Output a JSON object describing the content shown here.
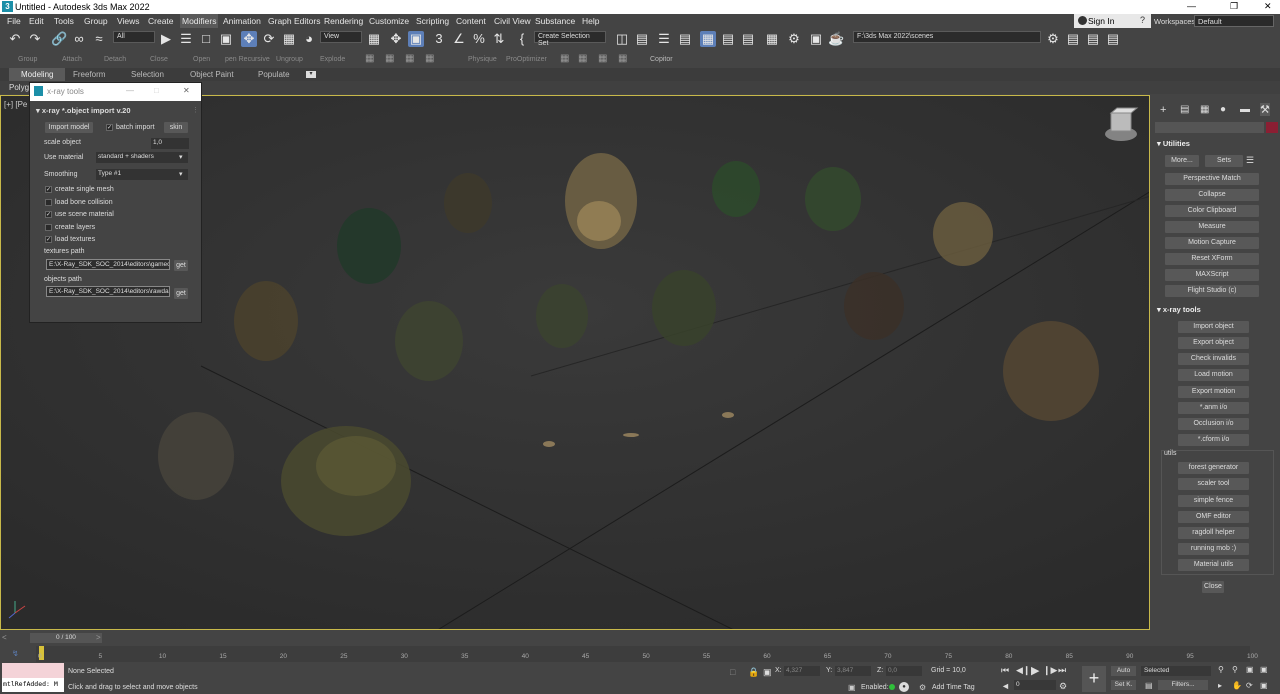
{
  "window": {
    "title": "Untitled - Autodesk 3ds Max 2022"
  },
  "menu": [
    "File",
    "Edit",
    "Tools",
    "Group",
    "Views",
    "Create",
    "Modifiers",
    "Animation",
    "Graph Editors",
    "Rendering",
    "Customize",
    "Scripting",
    "Content",
    "Civil View",
    "Substance",
    "Help"
  ],
  "sign_in": "Sign In",
  "workspace": {
    "label": "Workspaces:",
    "value": "Default"
  },
  "toolbar": {
    "filter": "All",
    "ref_coord": "View",
    "selection_set": "Create Selection Set",
    "path": "F:\\3ds Max 2022\\scenes"
  },
  "ribbon_labels": [
    "Group",
    "Attach",
    "Detach",
    "Close",
    "Open",
    "pen Recursive",
    "Ungroup",
    "Explode",
    "Physique",
    "ProOptimizer",
    "Copitor"
  ],
  "ribbon_tabs": [
    "Modeling",
    "Freeform",
    "Selection",
    "Object Paint",
    "Populate"
  ],
  "ribbon_poly": "Polyg",
  "viewport_label": "[+] [Pe",
  "xray": {
    "window_title": "x-ray tools",
    "panel_title": "x-ray *.object import v.20",
    "import_model": "Import model",
    "batch_import": "batch import",
    "skin": "skin",
    "scale_label": "scale object",
    "scale_value": "1,0",
    "use_material_label": "Use material",
    "use_material_value": "standard + shaders",
    "smoothing_label": "Smoothing",
    "smoothing_value": "Type #1",
    "checks": [
      {
        "label": "create single mesh",
        "checked": true
      },
      {
        "label": "load bone collision",
        "checked": false
      },
      {
        "label": "use scene material",
        "checked": true
      },
      {
        "label": "create layers",
        "checked": false
      },
      {
        "label": "load textures",
        "checked": true
      }
    ],
    "textures_label": "textures path",
    "textures_value": "E:\\X-Ray_SDK_SOC_2014\\editors\\gamec",
    "objects_label": "objects path",
    "objects_value": "E:\\X-Ray_SDK_SOC_2014\\editors\\rawda",
    "get": "get"
  },
  "command_panel": {
    "utilities_title": "Utilities",
    "more": "More...",
    "sets": "Sets",
    "utilities": [
      "Perspective Match",
      "Collapse",
      "Color Clipboard",
      "Measure",
      "Motion Capture",
      "Reset XForm",
      "MAXScript",
      "Flight Studio (c)"
    ],
    "xray_title": "x-ray tools",
    "xray_buttons": [
      "Import object",
      "Export object",
      "Check invalids",
      "Load motion",
      "Export motion",
      "*.anm i/o",
      "Occlusion i/o",
      "*.cform i/o"
    ],
    "utils_label": "utils",
    "utils_buttons": [
      "forest generator",
      "scaler tool",
      "simple fence",
      "OMF editor",
      "ragdoll helper",
      "running mob :)",
      "Material utils"
    ],
    "close": "Close"
  },
  "timeline": {
    "slider": "0 / 100",
    "ticks": [
      "0",
      "5",
      "10",
      "15",
      "20",
      "25",
      "30",
      "35",
      "40",
      "45",
      "50",
      "55",
      "60",
      "65",
      "70",
      "75",
      "80",
      "85",
      "90",
      "95",
      "100"
    ]
  },
  "status": {
    "selection": "None Selected",
    "prompt": "Click and drag to select and move objects",
    "maxscript": "mtlRefAdded: M",
    "x_label": "X:",
    "x_value": "4,327",
    "y_label": "Y:",
    "y_value": "3,847",
    "z_label": "Z:",
    "z_value": "0,0",
    "grid": "Grid = 10,0",
    "enabled": "Enabled:",
    "add_time_tag": "Add Time Tag",
    "auto": "Auto",
    "set_key": "Set K.",
    "selected": "Selected",
    "filters": "Filters...",
    "frame": "0"
  },
  "colors": {
    "accent": "#5d7fb8",
    "viewport_border": "#c8b94a",
    "enabled_dot": "#2fbf3a"
  }
}
